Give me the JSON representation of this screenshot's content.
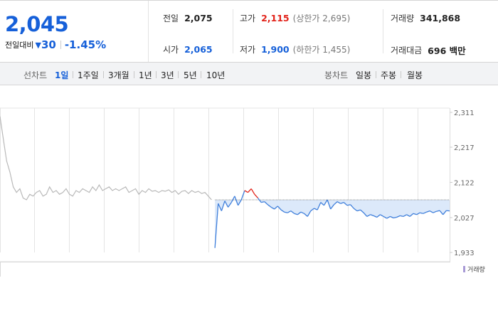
{
  "quote": {
    "price": "2,045",
    "change_label": "전일대비",
    "change_icon": "triangle-down-icon",
    "change_amount": "30",
    "change_percent": "-1.45%"
  },
  "stats": {
    "prev_close": {
      "label": "전일",
      "value": "2,075"
    },
    "open": {
      "label": "시가",
      "value": "2,065"
    },
    "high": {
      "label": "고가",
      "value": "2,115",
      "limit": "(상한가 2,695)"
    },
    "low": {
      "label": "저가",
      "value": "1,900",
      "limit": "(하한가 1,455)"
    },
    "volume": {
      "label": "거래량",
      "value": "341,868"
    },
    "turnover": {
      "label": "거래대금",
      "value": "696 백만"
    }
  },
  "tabs": {
    "line_label": "선차트",
    "line_periods": [
      "1일",
      "1주일",
      "3개월",
      "1년",
      "3년",
      "5년",
      "10년"
    ],
    "candle_label": "봉차트",
    "candle_periods": [
      "일봉",
      "주봉",
      "월봉"
    ]
  },
  "colors": {
    "down": "#1660d9",
    "up": "#e2231a",
    "prev_line": "#999999",
    "fill": "#dce9fa"
  },
  "chart_data": {
    "type": "line",
    "y_ticks": [
      "2,311",
      "2,217",
      "2,122",
      "2,027",
      "1,933"
    ],
    "ylim": [
      1933,
      2311
    ],
    "reference_price": 2075,
    "grid": true,
    "legend": {
      "entries": [
        "거래량"
      ]
    },
    "series": [
      {
        "x": [
          0,
          1,
          2,
          3,
          4,
          5,
          6,
          7,
          8,
          9,
          10,
          11,
          12,
          13,
          14,
          15,
          16,
          17,
          18,
          19,
          20,
          21,
          22,
          23,
          24,
          25,
          26,
          27,
          28,
          29,
          30,
          31,
          32,
          33,
          34,
          35,
          36,
          37,
          38,
          39,
          40,
          41,
          42,
          43,
          44,
          45,
          46,
          47,
          48,
          49,
          50,
          51,
          52,
          53,
          54,
          55,
          56,
          57,
          58,
          59,
          60,
          61,
          62,
          63,
          64
        ],
        "y": [
          2300,
          2240,
          2180,
          2150,
          2110,
          2095,
          2105,
          2080,
          2075,
          2090,
          2085,
          2095,
          2100,
          2085,
          2090,
          2110,
          2095,
          2100,
          2090,
          2095,
          2105,
          2090,
          2085,
          2100,
          2095,
          2105,
          2100,
          2095,
          2110,
          2100,
          2115,
          2100,
          2105,
          2110,
          2100,
          2105,
          2100,
          2105,
          2110,
          2095,
          2100,
          2105,
          2090,
          2100,
          2095,
          2105,
          2098,
          2100,
          2095,
          2100,
          2098,
          2102,
          2095,
          2100,
          2090,
          2098,
          2100,
          2092,
          2100,
          2095,
          2098,
          2092,
          2095,
          2085,
          2075
        ]
      },
      {
        "x": [
          65,
          66,
          67,
          68,
          69,
          70,
          71,
          72,
          73,
          74,
          75,
          76,
          77,
          78,
          79,
          80,
          81,
          82,
          83,
          84,
          85,
          86,
          87,
          88,
          89,
          90,
          91,
          92,
          93,
          94,
          95,
          96,
          97,
          98,
          99,
          100,
          101,
          102,
          103,
          104,
          105,
          106,
          107,
          108,
          109,
          110,
          111,
          112,
          113,
          114,
          115,
          116,
          117,
          118,
          119,
          120,
          121,
          122,
          123,
          124,
          125,
          126,
          127,
          128,
          129,
          130,
          131,
          132,
          133,
          134,
          135,
          136
        ],
        "y": [
          1945,
          2065,
          2045,
          2072,
          2055,
          2068,
          2085,
          2060,
          2075,
          2100,
          2095,
          2105,
          2090,
          2080,
          2068,
          2070,
          2062,
          2055,
          2050,
          2058,
          2048,
          2042,
          2040,
          2045,
          2038,
          2035,
          2042,
          2038,
          2030,
          2045,
          2052,
          2048,
          2068,
          2060,
          2075,
          2050,
          2062,
          2070,
          2065,
          2068,
          2060,
          2062,
          2052,
          2045,
          2048,
          2040,
          2030,
          2035,
          2032,
          2028,
          2035,
          2030,
          2025,
          2030,
          2026,
          2028,
          2032,
          2030,
          2035,
          2030,
          2038,
          2035,
          2040,
          2038,
          2042,
          2045,
          2040,
          2044,
          2046,
          2035,
          2046,
          2045
        ]
      }
    ]
  },
  "volume_chart": {
    "legend_label": "거래량"
  }
}
